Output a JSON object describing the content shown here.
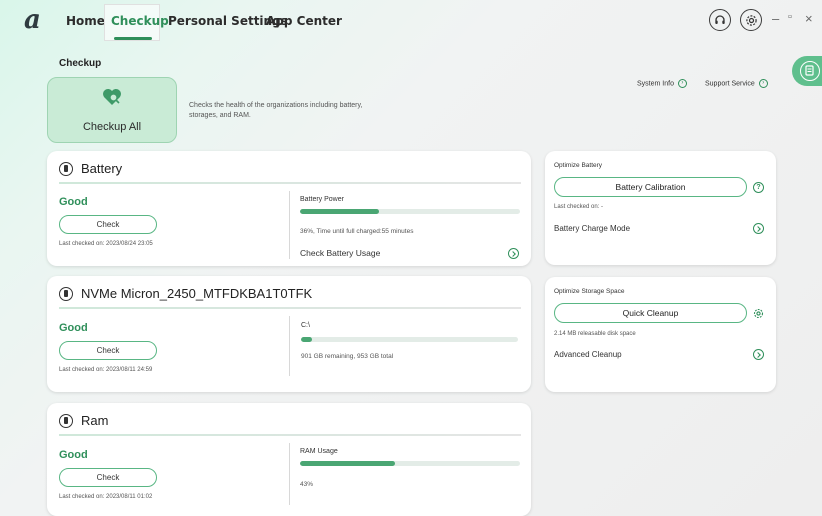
{
  "nav": {
    "logo": "a",
    "tabs": [
      {
        "label": "Home"
      },
      {
        "label": "Checkup"
      },
      {
        "label": "Personal Settings"
      },
      {
        "label": "App Center"
      }
    ],
    "active_tab": "Checkup",
    "icons": [
      "headset-icon",
      "gear-icon"
    ],
    "window_controls": [
      "–",
      "▫",
      "×"
    ]
  },
  "checkup": {
    "section_title": "Checkup",
    "checkup_all_label": "Checkup All",
    "description": "Checks the health of the organizations including battery, storages, and RAM.",
    "system_info": "System Info",
    "support_service": "Support Service"
  },
  "battery": {
    "title": "Battery",
    "status": "Good",
    "check_label": "Check",
    "last_checked": "Last checked on: 2023/08/24 23:05",
    "metric_label": "Battery Power",
    "metric_value": 0.36,
    "metric_text": "36%, Time until full charged:55 minutes",
    "usage_link": "Check Battery Usage"
  },
  "storage": {
    "title": "NVMe Micron_2450_MTFDKBA1T0TFK",
    "status": "Good",
    "check_label": "Check",
    "last_checked": "Last checked on: 2023/08/11 24:59",
    "metric_label": "C:\\",
    "metric_value": 0.05,
    "metric_text": "901 GB remaining, 953 GB total"
  },
  "ram": {
    "title": "Ram",
    "status": "Good",
    "check_label": "Check",
    "last_checked": "Last checked on: 2023/08/11 01:02",
    "metric_label": "RAM Usage",
    "metric_value": 0.43,
    "metric_text": "43%"
  },
  "optimize_battery": {
    "title": "Optimize Battery",
    "button": "Battery Calibration",
    "last_checked": "Last checked on: -",
    "link": "Battery Charge Mode"
  },
  "optimize_storage": {
    "title": "Optimize Storage Space",
    "button": "Quick Cleanup",
    "note": "2.14 MB releasable disk space",
    "link": "Advanced Cleanup"
  },
  "colors": {
    "accent": "#2f8f5a",
    "bar_fill": "#4aa673",
    "side_tab": "#5fbf8d"
  }
}
